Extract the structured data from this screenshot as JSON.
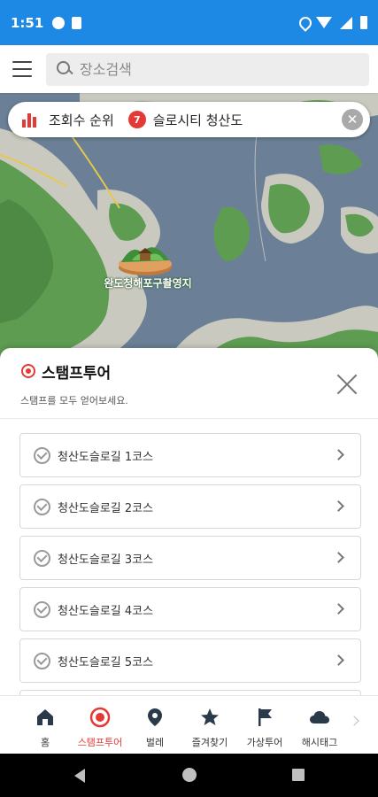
{
  "status_bar": {
    "time": "1:51"
  },
  "search": {
    "placeholder": "장소검색",
    "value": ""
  },
  "map": {
    "ranking_label": "조회수 순위",
    "rank_number": "7",
    "place_name": "슬로시티 청산도",
    "close_glyph": "✕",
    "marker_label": "완도청해포구촬영지"
  },
  "stamp_panel": {
    "title": "스탬프투어",
    "subtitle": "스탬프를 모두 얻어보세요.",
    "courses": [
      {
        "label": "청산도슬로길 1코스"
      },
      {
        "label": "청산도슬로길 2코스"
      },
      {
        "label": "청산도슬로길 3코스"
      },
      {
        "label": "청산도슬로길 4코스"
      },
      {
        "label": "청산도슬로길 5코스"
      }
    ]
  },
  "bottom_nav": {
    "items": [
      {
        "label": "홈",
        "icon": "home-icon"
      },
      {
        "label": "스탬프투어",
        "icon": "stamp-icon",
        "active": true
      },
      {
        "label": "벌레",
        "icon": "location-pin-icon"
      },
      {
        "label": "즐겨찾기",
        "icon": "star-icon"
      },
      {
        "label": "가상투어",
        "icon": "flag-icon"
      },
      {
        "label": "해시태그",
        "icon": "cloud-icon"
      }
    ]
  },
  "colors": {
    "status_bar": "#1e88e5",
    "accent": "#e53935",
    "water": "#6b8096",
    "land": "#c9c9c0",
    "forest": "#5e9c52"
  }
}
